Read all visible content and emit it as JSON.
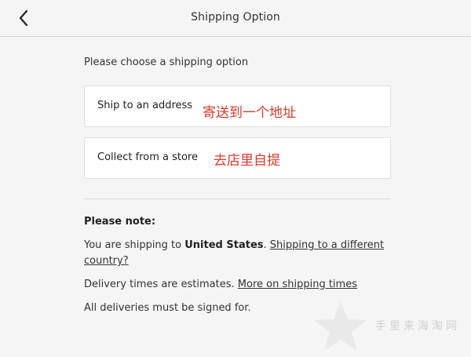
{
  "header": {
    "title": "Shipping Option",
    "back_icon": "chevron-left-icon"
  },
  "main": {
    "prompt": "Please choose a shipping option",
    "options": [
      {
        "label": "Ship to an address",
        "annotation": "寄送到一个地址"
      },
      {
        "label": "Collect from a store",
        "annotation": "去店里自提"
      }
    ],
    "note": {
      "heading": "Please note:",
      "line1_prefix": "You are shipping to ",
      "country": "United States",
      "line1_suffix": ". ",
      "change_country_link": "Shipping to a different country?",
      "line2_prefix": "Delivery times are estimates. ",
      "shipping_times_link": "More on shipping times",
      "line3": "All deliveries must be signed for."
    }
  },
  "watermark": {
    "text": "手里来海淘网",
    "icon": "star-icon"
  },
  "colors": {
    "background": "#f5f5f5",
    "annotation_red": "#d93a2b",
    "card_background": "#ffffff"
  }
}
